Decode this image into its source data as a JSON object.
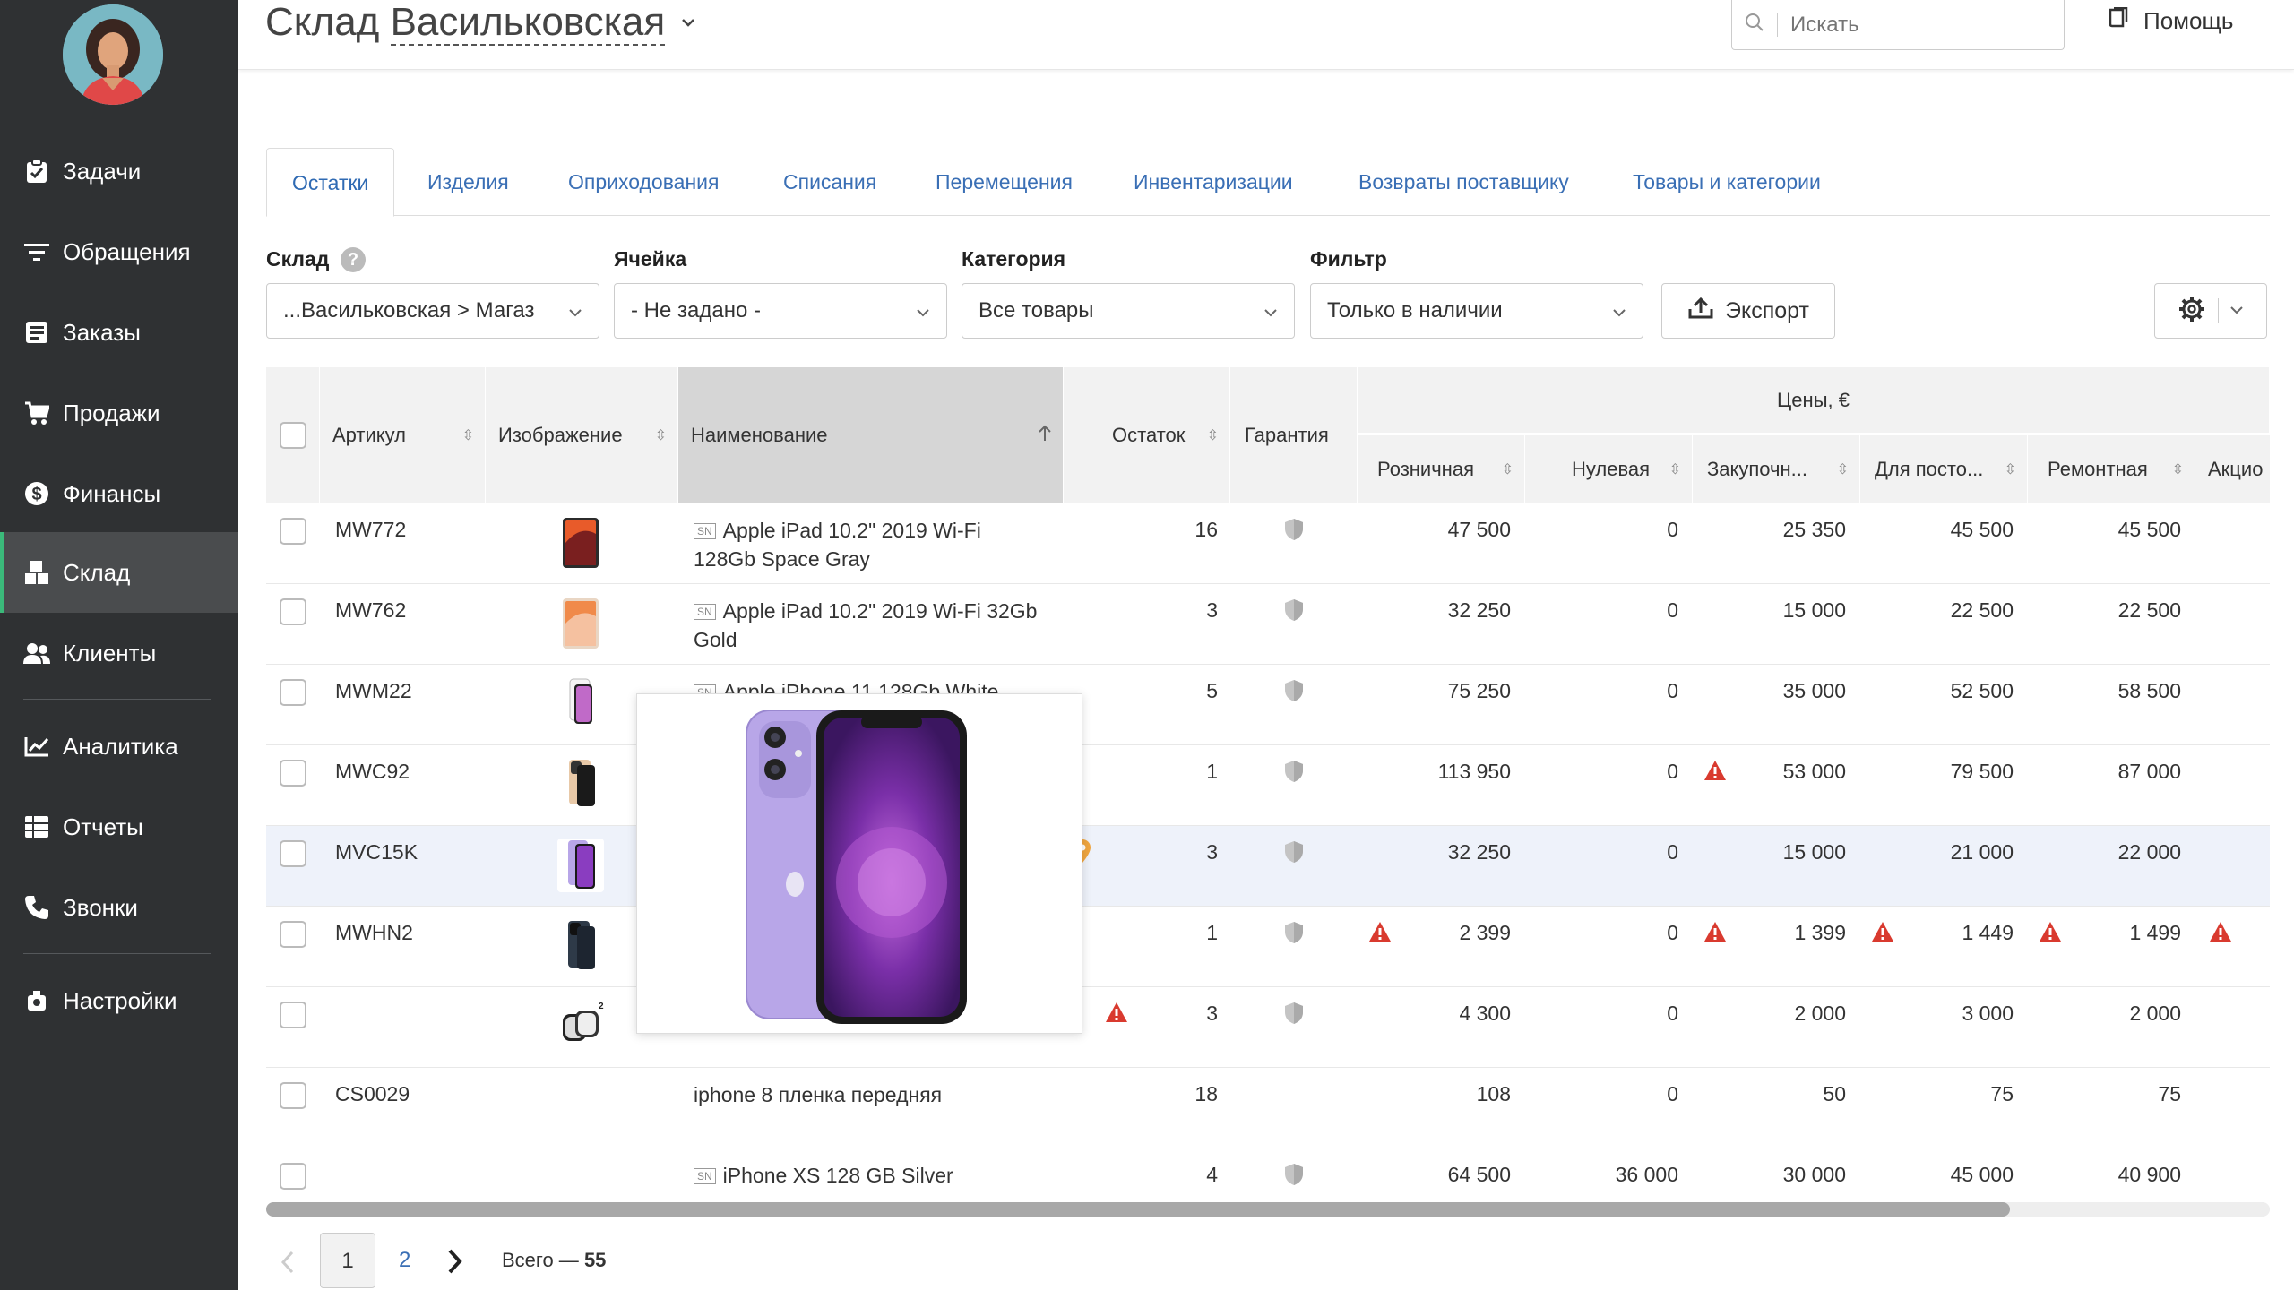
{
  "sidebar": {
    "items": [
      {
        "label": "Задачи",
        "icon": "clipboard-check-icon"
      },
      {
        "label": "Обращения",
        "icon": "filter-lines-icon"
      },
      {
        "label": "Заказы",
        "icon": "order-list-icon"
      },
      {
        "label": "Продажи",
        "icon": "cart-icon"
      },
      {
        "label": "Финансы",
        "icon": "dollar-coin-icon"
      },
      {
        "label": "Склад",
        "icon": "boxes-icon",
        "active": true
      },
      {
        "label": "Клиенты",
        "icon": "users-icon"
      },
      {
        "label": "Аналитика",
        "icon": "chart-line-icon"
      },
      {
        "label": "Отчеты",
        "icon": "report-table-icon"
      },
      {
        "label": "Звонки",
        "icon": "phone-icon"
      },
      {
        "label": "Настройки",
        "icon": "settings-icon"
      }
    ]
  },
  "header": {
    "title_prefix": "Склад",
    "title_warehouse": "Васильковская",
    "search_placeholder": "Искать",
    "help_label": "Помощь"
  },
  "tabs": [
    "Остатки",
    "Изделия",
    "Оприходования",
    "Списания",
    "Перемещения",
    "Инвентаризации",
    "Возвраты поставщику",
    "Товары и категории"
  ],
  "filters": {
    "warehouse": {
      "label": "Склад",
      "value": "...Васильковская > Магаз"
    },
    "cell": {
      "label": "Ячейка",
      "value": "- Не задано -"
    },
    "category": {
      "label": "Категория",
      "value": "Все товары"
    },
    "filter": {
      "label": "Фильтр",
      "value": "Только в наличии"
    },
    "export_label": "Экспорт",
    "help_mark": "?"
  },
  "table": {
    "columns": {
      "article": "Артикул",
      "image": "Изображение",
      "name": "Наименование",
      "stock": "Остаток",
      "warranty": "Гарантия",
      "prices_group": "Цены, €",
      "retail": "Розничная",
      "zero": "Нулевая",
      "purchase": "Закупочн...",
      "regular": "Для посто...",
      "repair": "Ремонтная",
      "promo": "Акцио"
    },
    "rows": [
      {
        "article": "MW772",
        "sn": true,
        "name1": "Apple iPad 10.2\" 2019 Wi-Fi",
        "name2": "128Gb Space Gray",
        "stock": "16",
        "warranty": true,
        "retail": "47 500",
        "zero": "0",
        "purchase": "25 350",
        "regular": "45 500",
        "repair": "45 500"
      },
      {
        "article": "MW762",
        "sn": true,
        "name1": "Apple iPad 10.2\" 2019 Wi-Fi 32Gb",
        "name2": "Gold",
        "stock": "3",
        "warranty": true,
        "retail": "32 250",
        "zero": "0",
        "purchase": "15 000",
        "regular": "22 500",
        "repair": "22 500"
      },
      {
        "article": "MWM22",
        "sn": true,
        "name1": "Apple iPhone 11 128Gb White",
        "name2": "",
        "stock": "5",
        "warranty": true,
        "retail": "75 250",
        "zero": "0",
        "purchase": "35 000",
        "regular": "52 500",
        "repair": "58 500"
      },
      {
        "article": "MWC92",
        "sn": false,
        "name1": "",
        "name2": "",
        "stock": "1",
        "warranty": true,
        "retail": "113 950",
        "zero": "0",
        "purchase": "53 000",
        "regular": "79 500",
        "repair": "87 000"
      },
      {
        "article": "MVC15K",
        "sn": false,
        "name1": "",
        "name2": "",
        "stock": "3",
        "warranty": true,
        "retail": "32 250",
        "zero": "0",
        "purchase": "15 000",
        "regular": "21 000",
        "repair": "22 000"
      },
      {
        "article": "MWHN2",
        "sn": false,
        "name1": "",
        "name2": "",
        "stock": "1",
        "warranty": true,
        "retail": "2 399",
        "zero": "0",
        "purchase": "1 399",
        "regular": "1 449",
        "repair": "1 499"
      },
      {
        "article": "",
        "sn": false,
        "name1": "",
        "name2": "",
        "stock": "3",
        "warranty": true,
        "retail": "4 300",
        "zero": "0",
        "purchase": "2 000",
        "regular": "3 000",
        "repair": "2 000"
      },
      {
        "article": "CS0029",
        "sn": false,
        "name1": "iphone 8 пленка передняя",
        "name2": "",
        "stock": "18",
        "warranty": false,
        "retail": "108",
        "zero": "0",
        "purchase": "50",
        "regular": "75",
        "repair": "75"
      },
      {
        "article": "",
        "sn": true,
        "name1": "iPhone XS 128 GB Silver",
        "name2": "",
        "stock": "4",
        "warranty": true,
        "retail": "64 500",
        "zero": "36 000",
        "purchase": "30 000",
        "regular": "45 000",
        "repair": "40 900"
      }
    ],
    "sn_tag": "SN",
    "watch_badge": "2"
  },
  "pagination": {
    "page1": "1",
    "page2": "2",
    "total_label": "Всего —",
    "total_value": "55"
  },
  "colors": {
    "sidebar_bg": "#2f3133",
    "active_accent": "#3bb97a",
    "link_blue": "#3a6fb5",
    "warning_red": "#d93a2f",
    "pin_orange": "#f0a640"
  }
}
